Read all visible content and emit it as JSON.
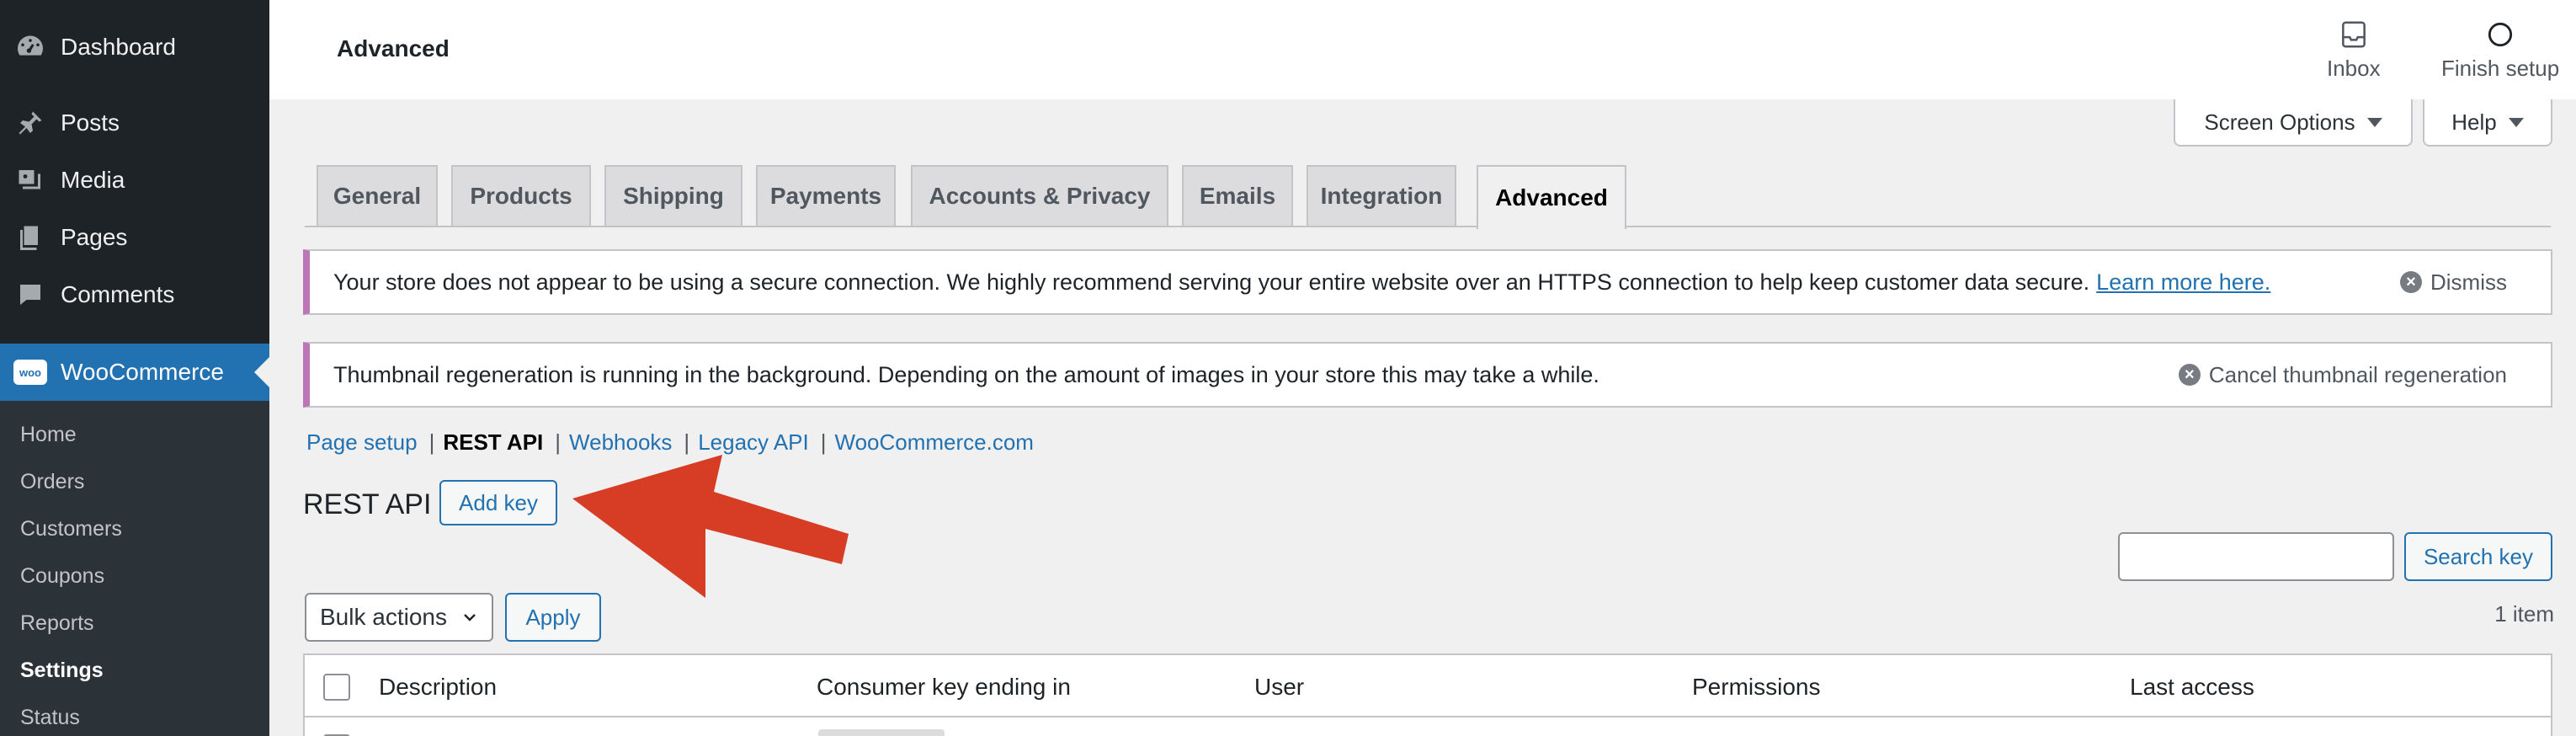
{
  "sidebar": {
    "items": [
      {
        "label": "Dashboard",
        "icon": "dashboard-icon"
      },
      {
        "label": "Posts",
        "icon": "pin-icon"
      },
      {
        "label": "Media",
        "icon": "media-icon"
      },
      {
        "label": "Pages",
        "icon": "pages-icon"
      },
      {
        "label": "Comments",
        "icon": "comment-icon"
      },
      {
        "label": "WooCommerce",
        "icon": "woo-icon"
      }
    ],
    "woo_logo_text": "woo",
    "submenu": [
      "Home",
      "Orders",
      "Customers",
      "Coupons",
      "Reports",
      "Settings",
      "Status"
    ]
  },
  "header": {
    "title": "Advanced",
    "inbox_label": "Inbox",
    "finish_setup_label": "Finish setup",
    "screen_options_label": "Screen Options",
    "help_label": "Help"
  },
  "tabs": [
    "General",
    "Products",
    "Shipping",
    "Payments",
    "Accounts & Privacy",
    "Emails",
    "Integration",
    "Advanced"
  ],
  "notices": {
    "secure": {
      "message": "Your store does not appear to be using a secure connection. We highly recommend serving your entire website over an HTTPS connection to help keep customer data secure.",
      "link": "Learn more here.",
      "dismiss": "Dismiss"
    },
    "thumb": {
      "message": "Thumbnail regeneration is running in the background. Depending on the amount of images in your store this may take a while.",
      "cancel": "Cancel thumbnail regeneration"
    }
  },
  "subsub": {
    "page_setup": "Page setup",
    "rest_api": "REST API",
    "webhooks": "Webhooks",
    "legacy_api": "Legacy API",
    "woocommerce_com": "WooCommerce.com",
    "sep": "|"
  },
  "main": {
    "heading": "REST API",
    "add_key": "Add key",
    "search_key": "Search key",
    "bulk_actions": "Bulk actions",
    "apply": "Apply",
    "item_count": "1 item"
  },
  "table": {
    "columns": [
      "Description",
      "Consumer key ending in",
      "User",
      "Permissions",
      "Last access"
    ]
  },
  "colors": {
    "sidebar_bg": "#1d2327",
    "accent": "#2271b1",
    "annotation_arrow": "#d63d24"
  }
}
